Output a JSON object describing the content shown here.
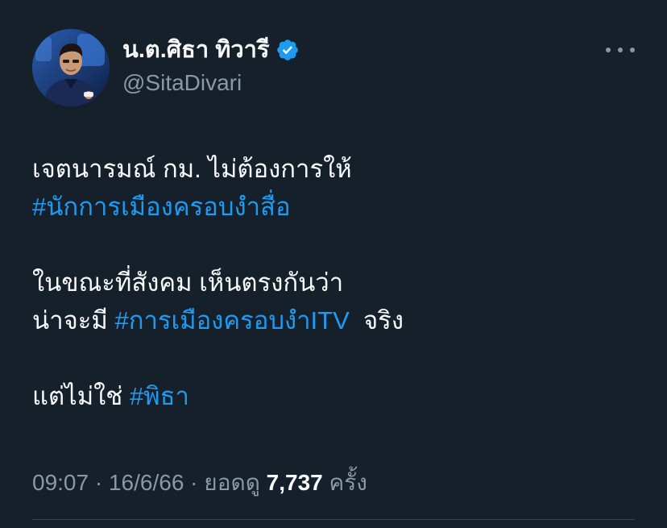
{
  "author": {
    "display_name": "น.ต.ศิธา ทิวารี",
    "handle": "@SitaDivari",
    "verified": true,
    "verified_icon": "verified-badge-icon",
    "avatar_icon": "profile-avatar"
  },
  "menu_icon": "more-options-icon",
  "tweet": {
    "line1": "เจตนารมณ์ กม. ไม่ต้องการให้",
    "hashtag1": "#นักการเมืองครอบงำสื่อ",
    "line3": "ในขณะที่สังคม เห็นตรงกันว่า",
    "line4_prefix": "น่าจะมี ",
    "hashtag2": "#การเมืองครอบงำITV",
    "line4_suffix": "  จริง",
    "line5_prefix": "แต่ไม่ใช่ ",
    "hashtag3": "#พิธา"
  },
  "meta": {
    "time": "09:07",
    "sep1": " · ",
    "date": "16/6/66",
    "sep2": " · ",
    "views_label": "ยอดดู ",
    "views_count": "7,737",
    "views_unit": " ครั้ง"
  },
  "colors": {
    "background": "#15202b",
    "text": "#f7f9f9",
    "secondary": "#8b98a5",
    "accent": "#1d9bf0"
  }
}
